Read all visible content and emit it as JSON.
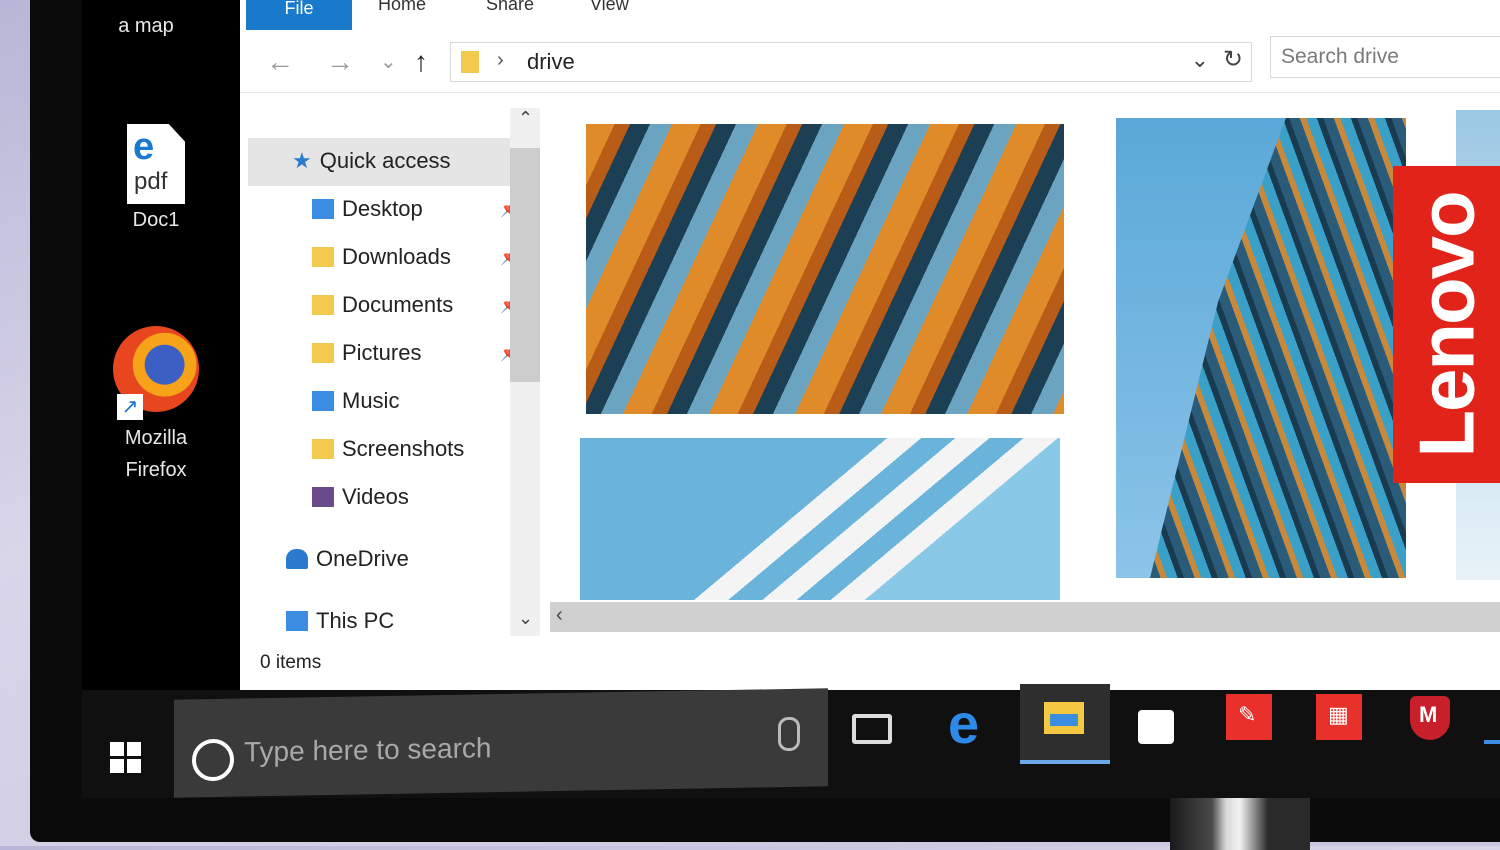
{
  "desktop": {
    "icons": [
      {
        "label": "a map"
      },
      {
        "label": "Doc1",
        "glyph": "e",
        "sub": "pdf"
      },
      {
        "label_line1": "Mozilla",
        "label_line2": "Firefox",
        "shortcut": "↗"
      }
    ]
  },
  "ribbon": {
    "tabs": [
      "File",
      "Home",
      "Share",
      "View"
    ]
  },
  "address": {
    "back": "←",
    "forward": "→",
    "recent": "⌄",
    "up": "↑",
    "separator": "›",
    "path": "drive",
    "dropdown": "⌄",
    "refresh": "↻",
    "search_placeholder": "Search drive"
  },
  "navpane": {
    "quick_access": "Quick access",
    "items": [
      {
        "label": "Desktop",
        "pinned": true
      },
      {
        "label": "Downloads",
        "pinned": true
      },
      {
        "label": "Documents",
        "pinned": true
      },
      {
        "label": "Pictures",
        "pinned": true
      },
      {
        "label": "Music"
      },
      {
        "label": "Screenshots"
      },
      {
        "label": "Videos"
      }
    ],
    "onedrive": "OneDrive",
    "this_pc": "This PC",
    "pin_glyph": "📌",
    "scroll_up": "⌃",
    "scroll_down": "⌄"
  },
  "content": {
    "scroll_left": "‹"
  },
  "status": {
    "items_text": "0 items"
  },
  "taskbar": {
    "search_placeholder": "Type here to search",
    "edge_glyph": "e",
    "app_glyph_1": "✎",
    "app_glyph_2": "▦",
    "mcafee_glyph": "M"
  },
  "brand": {
    "name": "Lenovo",
    "color": "#e2231a"
  },
  "colors": {
    "accent": "#1979ca",
    "taskbar": "#101010"
  }
}
